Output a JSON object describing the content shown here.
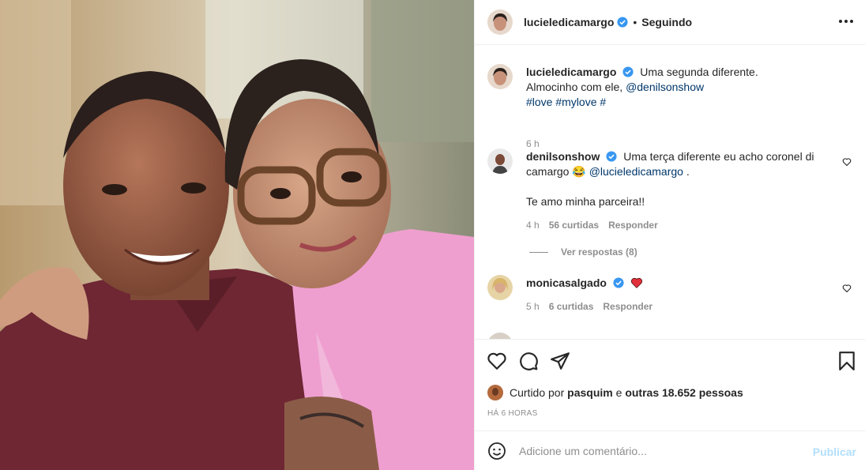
{
  "post": {
    "author": "lucieledicamargo",
    "follow_status": "Seguindo",
    "separator": "•"
  },
  "caption": {
    "username": "lucieledicamargo",
    "line1": "Uma segunda diferente.",
    "line2_prefix": "Almocinho com ele,",
    "mention": "@denilsonshow",
    "hashtag1": "#love",
    "hashtag2": "#mylove",
    "hashtag3": "#",
    "time": "6 h"
  },
  "comments": [
    {
      "username": "denilsonshow",
      "text1": "Uma terça diferente eu acho coronel di",
      "text2_prefix": "camargo",
      "emoji": "😂",
      "mention": "@lucieledicamargo",
      "text2_suffix": ".",
      "text3": "Te amo minha parceira!!",
      "time": "4 h",
      "likes": "56 curtidas",
      "reply": "Responder",
      "view_replies": "Ver respostas (8)"
    },
    {
      "username": "monicasalgado",
      "text": "",
      "time": "5 h",
      "likes": "6 curtidas",
      "reply": "Responder"
    }
  ],
  "likes_row": {
    "prefix": "Curtido por",
    "user": "pasquim",
    "middle": "e",
    "others": "outras 18.652 pessoas"
  },
  "timestamp": "HÁ 6 HORAS",
  "composer": {
    "placeholder": "Adicione um comentário...",
    "publish": "Publicar"
  },
  "icons": {
    "like": "heart-icon",
    "comment": "comment-icon",
    "share": "paper-plane-icon",
    "save": "bookmark-icon",
    "more": "more-icon",
    "emoji": "emoji-icon"
  },
  "colors": {
    "verified": "#3897f0",
    "link": "#00376b",
    "muted": "#8e8e8e",
    "publish_disabled": "#b2dffc",
    "heart_red": "#ed4956"
  }
}
